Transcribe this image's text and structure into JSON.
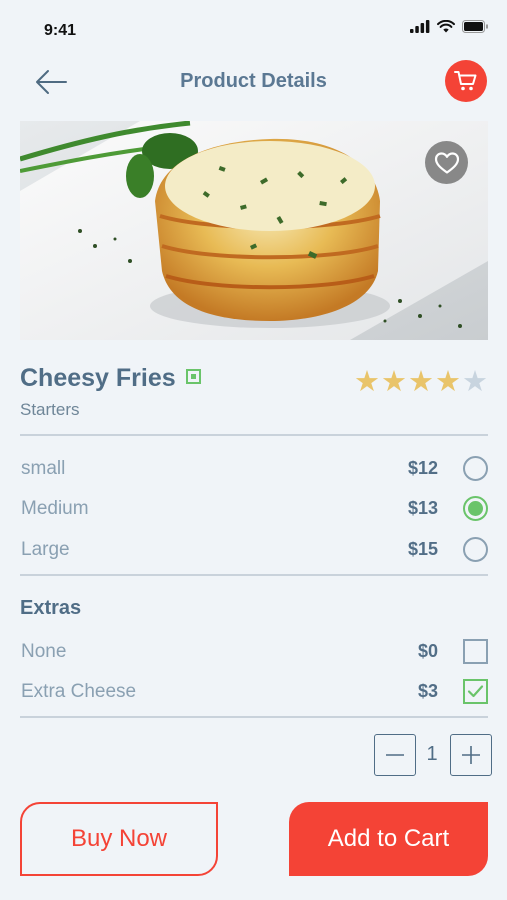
{
  "status_bar": {
    "time": "9:41"
  },
  "header": {
    "title": "Product Details"
  },
  "product": {
    "name": "Cheesy Fries",
    "category": "Starters",
    "rating": 4,
    "rating_max": 5,
    "favorite": false
  },
  "sizes": [
    {
      "label": "small",
      "price": "$12",
      "selected": false
    },
    {
      "label": "Medium",
      "price": "$13",
      "selected": true
    },
    {
      "label": "Large",
      "price": "$15",
      "selected": false
    }
  ],
  "extras": {
    "title": "Extras",
    "items": [
      {
        "label": "None",
        "price": "$0",
        "checked": false
      },
      {
        "label": "Extra Cheese",
        "price": "$3",
        "checked": true
      }
    ]
  },
  "quantity": {
    "value": "1"
  },
  "actions": {
    "buy_now": "Buy Now",
    "add_to_cart": "Add to Cart"
  },
  "colors": {
    "accent": "#f44336",
    "selected": "#6ac46a",
    "star_filled": "#e9c46a",
    "star_empty": "#c8d4df",
    "background": "#f0f4f8"
  }
}
